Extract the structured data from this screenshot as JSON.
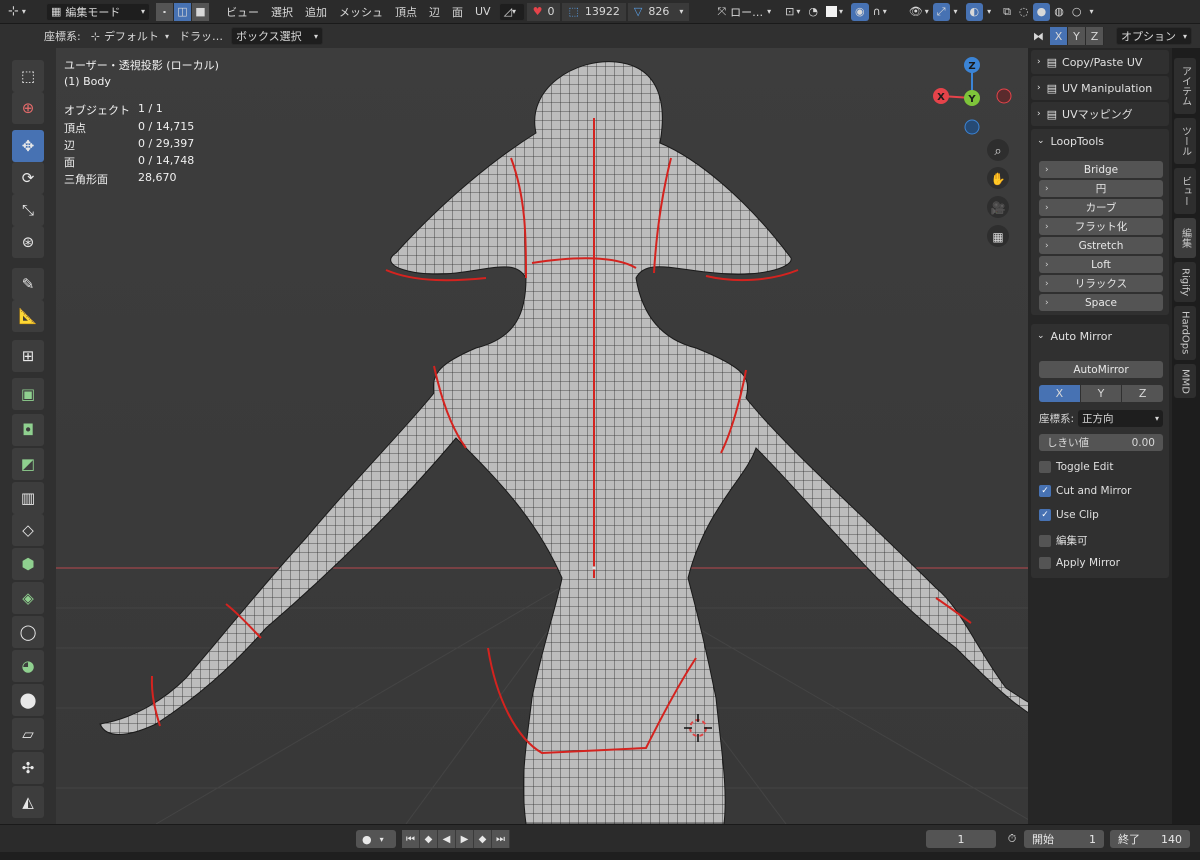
{
  "header": {
    "mode_label": "編集モード",
    "menus": [
      "ビュー",
      "選択",
      "追加",
      "メッシュ",
      "頂点",
      "辺",
      "面",
      "UV"
    ],
    "stat_hidden": "0",
    "stat_verts": "13922",
    "stat_faces": "826",
    "pivot_label": "ロー…"
  },
  "toolrow": {
    "orientation_label": "座標系:",
    "orientation_value": "デフォルト",
    "drag_label": "ドラッ…",
    "select_mode": "ボックス選択",
    "axis_x": "X",
    "axis_y": "Y",
    "axis_z": "Z",
    "options_label": "オプション"
  },
  "viewport": {
    "view_title": "ユーザー・透視投影 (ローカル)",
    "object_name": "(1) Body",
    "stats": [
      {
        "key": "オブジェクト",
        "val": "1 / 1"
      },
      {
        "key": "頂点",
        "val": "0 / 14,715"
      },
      {
        "key": "辺",
        "val": "0 / 29,397"
      },
      {
        "key": "面",
        "val": "0 / 14,748"
      },
      {
        "key": "三角形面",
        "val": "28,670"
      }
    ],
    "gizmo": {
      "x": "X",
      "y": "Y",
      "z": "Z",
      "x_color": "#e5434a",
      "y_color": "#7ec43a",
      "z_color": "#3b84d6"
    }
  },
  "npanel": {
    "copy_paste_uv": "Copy/Paste UV",
    "uv_manipulation": "UV Manipulation",
    "uv_mapping": "UVマッピング",
    "looptools_title": "LoopTools",
    "looptools_buttons": [
      "Bridge",
      "円",
      "カーブ",
      "フラット化",
      "Gstretch",
      "Loft",
      "リラックス",
      "Space"
    ],
    "automirror_title": "Auto Mirror",
    "automirror_button": "AutoMirror",
    "axis_x": "X",
    "axis_y": "Y",
    "axis_z": "Z",
    "orientation_label": "座標系:",
    "orientation_value": "正方向",
    "threshold_label": "しきい値",
    "threshold_value": "0.00",
    "options": [
      {
        "label": "Toggle Edit",
        "checked": false
      },
      {
        "label": "Cut and Mirror",
        "checked": true
      },
      {
        "label": "Use Clip",
        "checked": true
      },
      {
        "label": "編集可",
        "checked": false
      },
      {
        "label": "Apply Mirror",
        "checked": false
      }
    ]
  },
  "tabs": [
    "アイテム",
    "ツール",
    "ビュー",
    "編集",
    "Rigify",
    "HardOps",
    "MMD"
  ],
  "timeline": {
    "current_frame": "1",
    "start_label": "開始",
    "start_value": "1",
    "end_label": "終了",
    "end_value": "140"
  },
  "colors": {
    "accent": "#4772b3",
    "seam": "#d4231f",
    "viewport_bg": "#3d3d3d"
  }
}
